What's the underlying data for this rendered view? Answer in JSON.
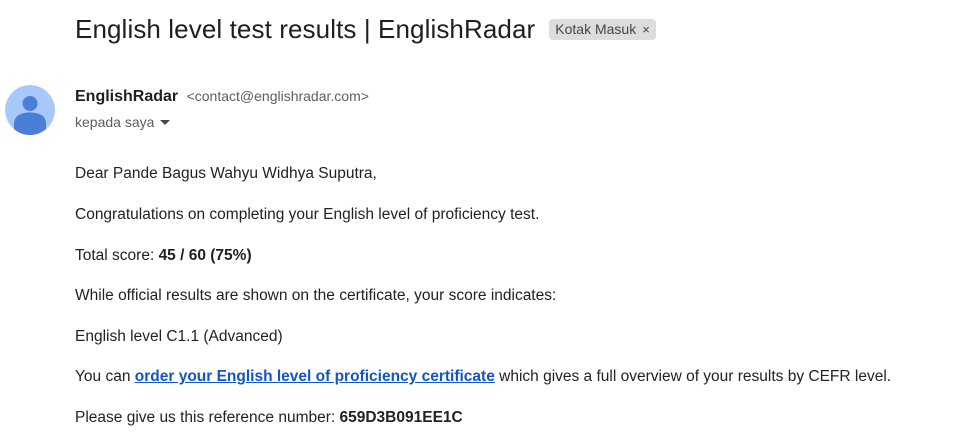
{
  "email": {
    "subject": "English level test results | EnglishRadar",
    "label_chip": {
      "text": "Kotak Masuk",
      "close_glyph": "×"
    },
    "sender": {
      "name": "EnglishRadar",
      "email": "<contact@englishradar.com>",
      "avatar_icon": "person-avatar-icon",
      "avatar_color": "#a8c7fa",
      "avatar_figure_color": "#4a7fd8"
    },
    "recipient_text": "kepada saya",
    "body": {
      "greeting": "Dear Pande Bagus Wahyu Widhya Suputra,",
      "congrats": "Congratulations on completing your English level of proficiency test.",
      "score_prefix": "Total score: ",
      "score_value": "45 / 60 (75%)",
      "note": "While official results are shown on the certificate, your score indicates:",
      "level": "English level C1.1 (Advanced)",
      "cta_prefix": "You can ",
      "cta_link": "order your English level of proficiency certificate",
      "cta_suffix": " which gives a full overview of your results by CEFR level.",
      "ref_prefix": "Please give us this reference number: ",
      "ref_value": "659D3B091EE1C"
    }
  },
  "colors": {
    "link": "#1155cc",
    "chip_bg": "#dddddd",
    "text": "#222222",
    "muted": "#5e5e5e"
  }
}
